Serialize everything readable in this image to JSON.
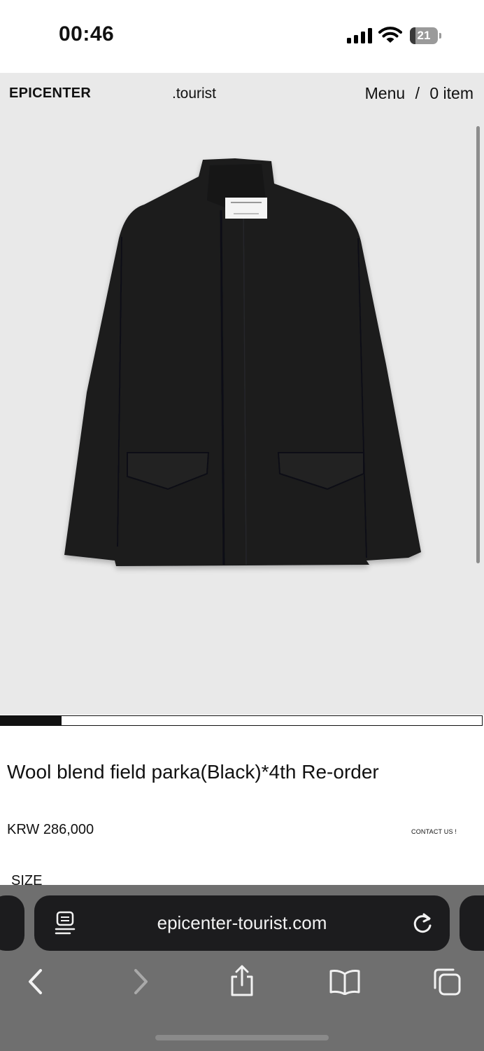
{
  "status_bar": {
    "time": "00:46",
    "battery_level": "21"
  },
  "header": {
    "brand": "EPICENTER",
    "sub_brand": ".tourist",
    "menu_label": "Menu",
    "separator": "/",
    "cart_label": "0 item"
  },
  "product": {
    "title": "Wool blend field parka(Black)*4th Re-order",
    "price": "KRW 286,000",
    "contact_label": "CONTACT US !",
    "size_label": "SIZE",
    "image_colors": {
      "background": "#e9e9e9",
      "garment": "#1b1c1e"
    },
    "carousel_position_fraction": 0.127
  },
  "browser": {
    "url": "epicenter-tourist.com",
    "icons": [
      "reader-icon",
      "reload-icon",
      "back-icon",
      "forward-icon",
      "share-icon",
      "bookmarks-icon",
      "tabs-icon"
    ]
  }
}
